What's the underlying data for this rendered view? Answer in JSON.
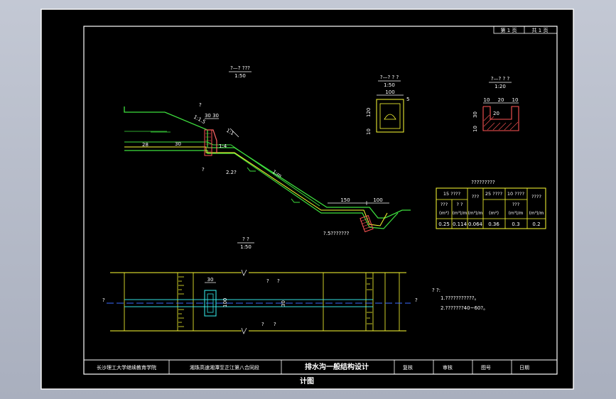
{
  "sheet": {
    "page_label": "第 1 页",
    "total_label": "共 1 页"
  },
  "title_block": {
    "school": "长沙理工大学继续教育学院",
    "project": "湘珠高速湘潭至芷江第八合同段",
    "drawing_title_1": "排水沟一般结构设计",
    "drawing_title_2": "计图",
    "checked": "复核",
    "reviewed": "审核",
    "drawing_no": "图号",
    "date": "日期"
  },
  "views": {
    "section_main": {
      "title": "?—? ???",
      "scale": "1:50"
    },
    "section_a": {
      "title": "?—? ? ?",
      "scale": "1:50"
    },
    "section_b": {
      "title": "?—? ? ?",
      "scale": "1:20"
    },
    "plan": {
      "title": "? ?",
      "scale": "1:50"
    }
  },
  "dimensions": {
    "d_30_30": "30 30",
    "d_1_1_5": "1:1.5",
    "d_1_1": "1:1",
    "d_1m": "1:m",
    "d_1_4": "1:4",
    "d_28": "28",
    "d_30": "30",
    "d_150": "150",
    "d_100": "100",
    "d_a_100": "100",
    "d_a_120": "120",
    "d_a_10": "10",
    "d_a_5": "5",
    "d_b_10a": "10",
    "d_b_20": "20",
    "d_b_10b": "10",
    "d_b_30": "30",
    "d_b_10c": "10",
    "d_b_inner20": "20",
    "d_plan_30": "30",
    "d_plan_100": "100",
    "d_plan_30b": "30",
    "d_gutter": "?.5???????",
    "d_227": "2.2?",
    "q_mark": "?"
  },
  "quantity_table": {
    "title": "?????????",
    "headers": [
      "15 ????",
      "???",
      "25 ????",
      "10 ????",
      "????"
    ],
    "subheaders": [
      "???",
      "? ?",
      "",
      "???",
      "????",
      ""
    ],
    "units": [
      "(m²)",
      "(m³)/m",
      "(m³)/m",
      "(m²)",
      "(m³)/m",
      "(m³)/m"
    ],
    "values": [
      "0.25",
      "0.114",
      "0.064",
      "0.36",
      "0.3",
      "0.2"
    ]
  },
  "notes": {
    "head": "? ?:",
    "line1": "1.???????????。",
    "line2": "2.???????40~60?。"
  },
  "plan_labels": {
    "left": "?",
    "right": "?",
    "q1": "?",
    "q2": "?",
    "q3": "?",
    "q4": "?"
  }
}
